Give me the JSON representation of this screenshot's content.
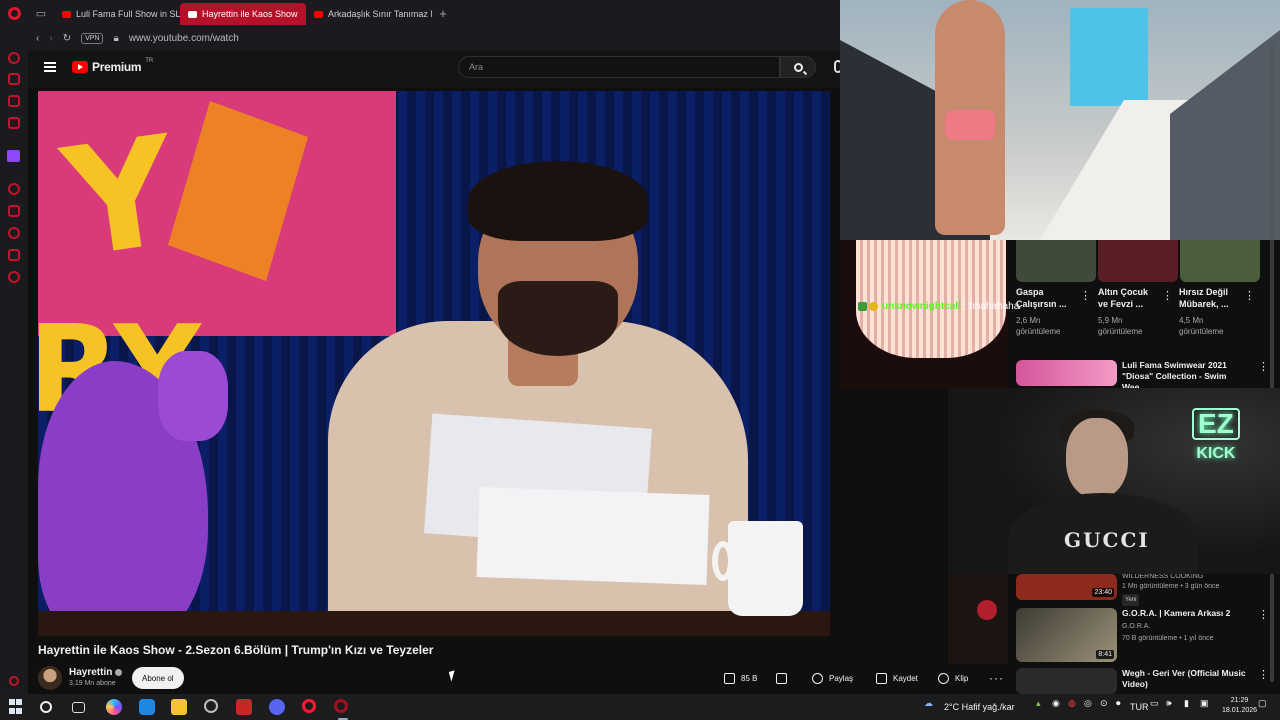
{
  "browser": {
    "tabs": [
      {
        "label": "Luli Fama Full Show in SLO",
        "active": false
      },
      {
        "label": "Hayrettin ile Kaos Show",
        "active": true
      },
      {
        "label": "Arkadaşlık Sınır Tanımaz M",
        "active": false
      }
    ],
    "vpn_label": "VPN",
    "url": "www.youtube.com/watch"
  },
  "youtube": {
    "logo_text": "Premium",
    "logo_sup": "TR",
    "search_placeholder": "Ara",
    "video_title": "Hayrettin ile Kaos Show - 2.Sezon 6.Bölüm | Trump'ın Kızı ve Teyzeler",
    "channel_name": "Hayrettin",
    "channel_subs": "3,19 Mn abone",
    "subscribe_label": "Abone ol",
    "likes": "85 B",
    "share_label": "Paylaş",
    "save_label": "Kaydet",
    "clip_label": "Klip"
  },
  "overlay": {
    "chat_user": "unknownightcall",
    "chat_sep": " : ",
    "chat_text": "hhahahaha",
    "cam_shirt": "GUCCI",
    "sign_top": "EZ",
    "sign_bottom": "KICK"
  },
  "recommendations": {
    "top_cards": [
      {
        "title_1": "Gaspa",
        "title_2": "Çalışırsın ...",
        "views_1": "2,6 Mn",
        "views_2": "görüntüleme"
      },
      {
        "title_1": "Altın Çocuk",
        "title_2": "ve Fevzi ...",
        "views_1": "5,9 Mn",
        "views_2": "görüntüleme"
      },
      {
        "title_1": "Hırsız Değil",
        "title_2": "Mübarek, ...",
        "views_1": "4,5 Mn",
        "views_2": "görüntüleme"
      }
    ],
    "items": [
      {
        "title": "Luli Fama Swimwear 2021 \"Diosa\" Collection - Swim Wee...",
        "channel": "",
        "meta": "",
        "duration": "",
        "badge": ""
      },
      {
        "title": "",
        "channel": "WILDERNESS COOKING",
        "meta": "1 Mn görüntüleme • 3 gün önce",
        "duration": "23:40",
        "badge": "Yeni"
      },
      {
        "title": "G.O.R.A. | Kamera Arkası 2",
        "channel": "G.O.R.A.",
        "meta": "70 B görüntüleme • 1 yıl önce",
        "duration": "8:41",
        "badge": ""
      },
      {
        "title": "Wegh - Geri Ver (Official Music Video)",
        "channel": "",
        "meta": "",
        "duration": "",
        "badge": ""
      }
    ]
  },
  "taskbar": {
    "weather": "2°C  Hafif yağ./kar",
    "lang": "TUR",
    "time": "21:29",
    "date": "18.01.2026"
  },
  "colors": {
    "opera_red": "#e0162b",
    "active_tab": "#b5122a",
    "kick_green": "#53fc18",
    "youtube_red": "#ff0000"
  }
}
